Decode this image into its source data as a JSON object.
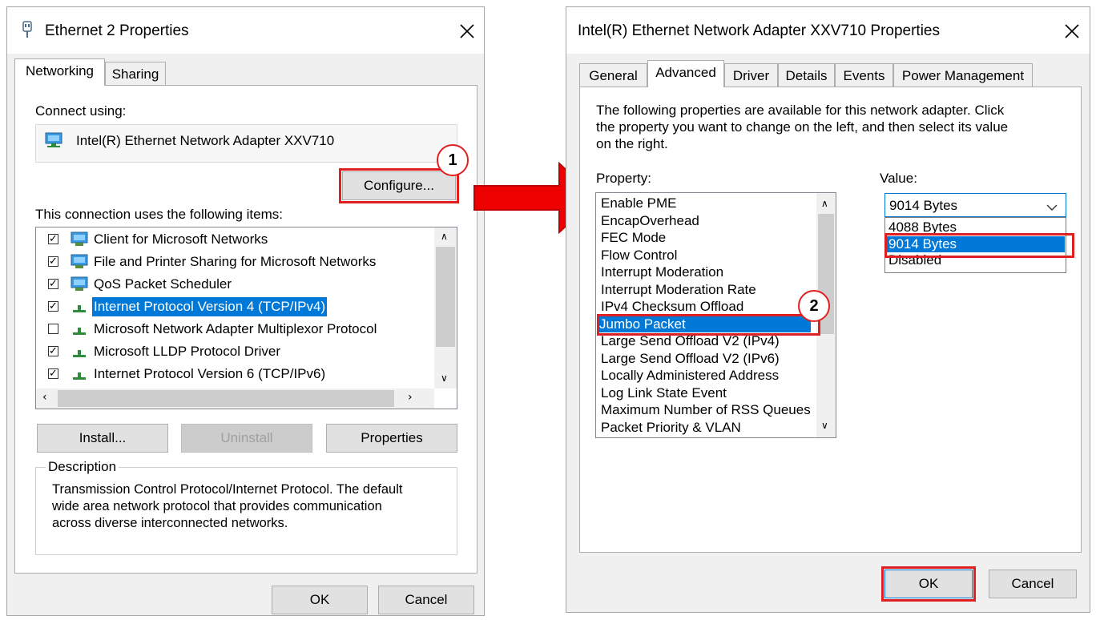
{
  "left_dialog": {
    "title": "Ethernet 2 Properties",
    "tabs": [
      {
        "label": "Networking"
      },
      {
        "label": "Sharing"
      }
    ],
    "connect_using_label": "Connect using:",
    "adapter_name": "Intel(R) Ethernet Network Adapter XXV710",
    "configure_button": "Configure...",
    "items_label": "This connection uses the following items:",
    "items": [
      {
        "label": "Client for Microsoft Networks",
        "checked": true,
        "selected": false
      },
      {
        "label": "File and Printer Sharing for Microsoft Networks",
        "checked": true,
        "selected": false
      },
      {
        "label": "QoS Packet Scheduler",
        "checked": true,
        "selected": false
      },
      {
        "label": "Internet Protocol Version 4 (TCP/IPv4)",
        "checked": true,
        "selected": true
      },
      {
        "label": "Microsoft Network Adapter Multiplexor Protocol",
        "checked": false,
        "selected": false
      },
      {
        "label": "Microsoft LLDP Protocol Driver",
        "checked": true,
        "selected": false
      },
      {
        "label": "Internet Protocol Version 6 (TCP/IPv6)",
        "checked": true,
        "selected": false
      }
    ],
    "install_button": "Install...",
    "uninstall_button": "Uninstall",
    "properties_button": "Properties",
    "description_label": "Description",
    "description_lines": [
      "Transmission Control Protocol/Internet Protocol. The default",
      "wide area network protocol that provides communication",
      "across diverse interconnected networks."
    ],
    "ok_button": "OK",
    "cancel_button": "Cancel"
  },
  "right_dialog": {
    "title": "Intel(R) Ethernet Network Adapter XXV710 Properties",
    "tabs": [
      {
        "label": "General"
      },
      {
        "label": "Advanced"
      },
      {
        "label": "Driver"
      },
      {
        "label": "Details"
      },
      {
        "label": "Events"
      },
      {
        "label": "Power Management"
      }
    ],
    "intro_lines": [
      "The following properties are available for this network adapter. Click",
      "the property you want to change on the left, and then select its value",
      "on the right."
    ],
    "property_label": "Property:",
    "value_label": "Value:",
    "properties": [
      "Enable PME",
      "EncapOverhead",
      "FEC Mode",
      "Flow Control",
      "Interrupt Moderation",
      "Interrupt Moderation Rate",
      "IPv4 Checksum Offload",
      "Jumbo Packet",
      "Large Send Offload V2 (IPv4)",
      "Large Send Offload V2 (IPv6)",
      "Locally Administered Address",
      "Log Link State Event",
      "Maximum Number of RSS Queues",
      "Packet Priority & VLAN"
    ],
    "selected_property": "Jumbo Packet",
    "value_selected": "9014 Bytes",
    "value_options": [
      "4088 Bytes",
      "9014 Bytes",
      "Disabled"
    ],
    "ok_button": "OK",
    "cancel_button": "Cancel"
  },
  "annotations": {
    "step1": "1",
    "step2": "2",
    "highlight_color": "#e02020"
  },
  "icons": {
    "close": "close-icon",
    "window": "network-adapter-icon",
    "adapter": "network-adapter-icon",
    "arrow": "red-arrow-icon"
  }
}
